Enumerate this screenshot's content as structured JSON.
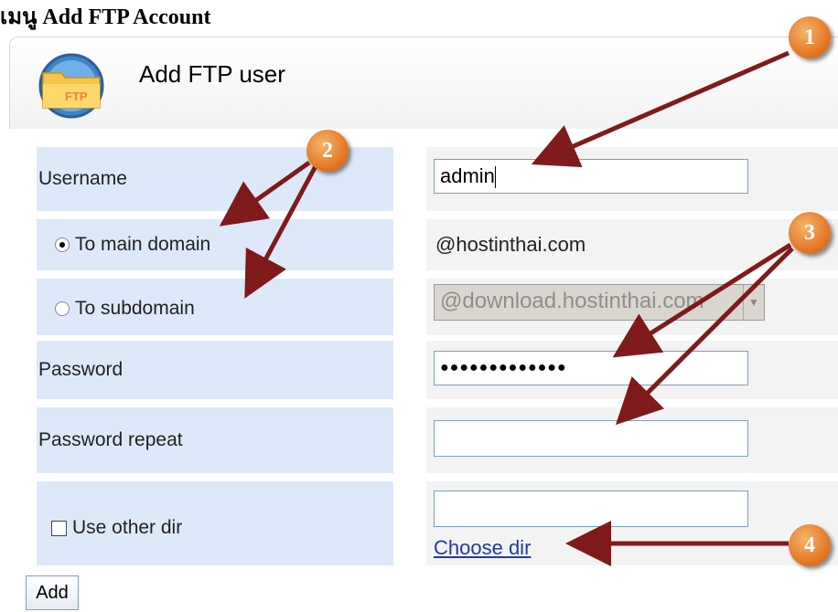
{
  "doc_title": "เมนู  Add  FTP Account",
  "panel": {
    "title": "Add FTP user",
    "icon": "ftp-folder-icon",
    "icon_text": "FTP"
  },
  "form": {
    "username_label": "Username",
    "username_value": "admin",
    "main_domain_label": "To main domain",
    "main_domain_value": "@hostinthai.com",
    "main_domain_selected": true,
    "subdomain_label": "To subdomain",
    "subdomain_select_value": "@download.hostinthai.com",
    "password_label": "Password",
    "password_value": "●●●●●●●●●●●●●",
    "password_repeat_label": "Password repeat",
    "password_repeat_value": "",
    "use_other_dir_label": "Use other dir",
    "other_dir_value": "",
    "choose_dir_link": "Choose dir",
    "add_button": "Add"
  },
  "annotations": [
    "1",
    "2",
    "3",
    "4"
  ],
  "colors": {
    "label_bg": "#dde9f9",
    "field_bg": "#f3f3f3",
    "badge": "#e0701d",
    "arrow": "#7a0f0f",
    "link": "#1f3aa8"
  }
}
